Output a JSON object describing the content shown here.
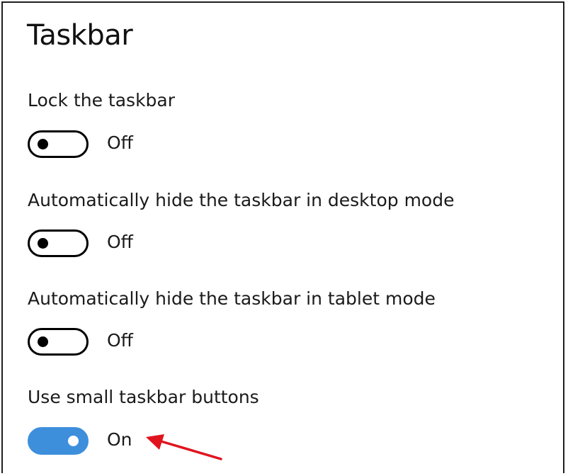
{
  "page": {
    "title": "Taskbar"
  },
  "settings": [
    {
      "label": "Lock the taskbar",
      "state": "Off",
      "enabled": false
    },
    {
      "label": "Automatically hide the taskbar in desktop mode",
      "state": "Off",
      "enabled": false
    },
    {
      "label": "Automatically hide the taskbar in tablet mode",
      "state": "Off",
      "enabled": false
    },
    {
      "label": "Use small taskbar buttons",
      "state": "On",
      "enabled": true
    }
  ],
  "colors": {
    "toggle_on": "#3d8fdc",
    "annotation_arrow": "#e0141e"
  },
  "annotation": {
    "icon": "red-arrow-icon"
  }
}
